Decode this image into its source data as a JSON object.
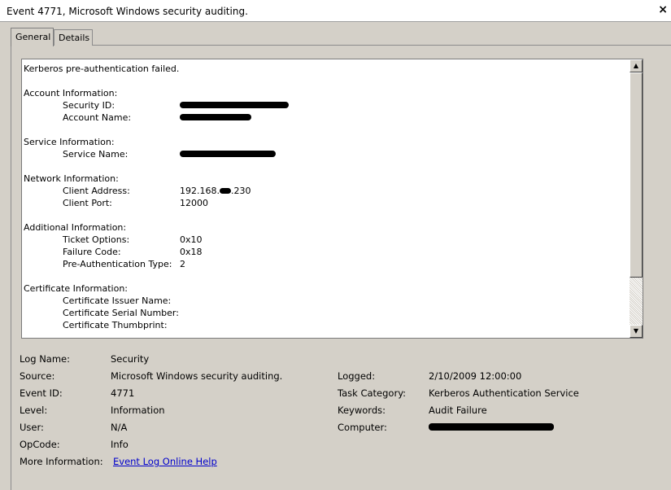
{
  "window": {
    "title": "Event 4771, Microsoft Windows security auditing.",
    "close_glyph": "×"
  },
  "tabs": [
    {
      "label": "General",
      "active": true
    },
    {
      "label": "Details",
      "active": false
    }
  ],
  "description": {
    "summary": "Kerberos pre-authentication failed.",
    "account_info": {
      "header": "Account Information:",
      "security_id_label": "Security ID:",
      "account_name_label": "Account Name:"
    },
    "service_info": {
      "header": "Service Information:",
      "service_name_label": "Service Name:"
    },
    "network_info": {
      "header": "Network Information:",
      "client_address_label": "Client Address:",
      "client_address_value": "192.168.",
      "client_address_suffix": ".230",
      "client_port_label": "Client Port:",
      "client_port_value": "12000"
    },
    "additional_info": {
      "header": "Additional Information:",
      "ticket_options_label": "Ticket Options:",
      "ticket_options_value": "0x10",
      "failure_code_label": "Failure Code:",
      "failure_code_value": "0x18",
      "preauth_type_label": "Pre-Authentication Type:",
      "preauth_type_value": "2"
    },
    "certificate_info": {
      "header": "Certificate Information:",
      "issuer_label": "Certificate Issuer Name:",
      "serial_label": "Certificate Serial Number:",
      "thumbprint_label": "Certificate Thumbprint:"
    }
  },
  "scroll": {
    "up_glyph": "▲",
    "down_glyph": "▼"
  },
  "details": {
    "log_name_label": "Log Name:",
    "log_name_value": "Security",
    "source_label": "Source:",
    "source_value": "Microsoft Windows security auditing.",
    "event_id_label": "Event ID:",
    "event_id_value": "4771",
    "level_label": "Level:",
    "level_value": "Information",
    "user_label": "User:",
    "user_value": "N/A",
    "opcode_label": "OpCode:",
    "opcode_value": "Info",
    "more_info_label": "More Information:",
    "more_info_link": "Event Log Online Help",
    "logged_label": "Logged:",
    "logged_value": "2/10/2009 12:00:00",
    "task_category_label": "Task Category:",
    "task_category_value": "Kerberos Authentication Service",
    "keywords_label": "Keywords:",
    "keywords_value": "Audit Failure",
    "computer_label": "Computer:"
  }
}
